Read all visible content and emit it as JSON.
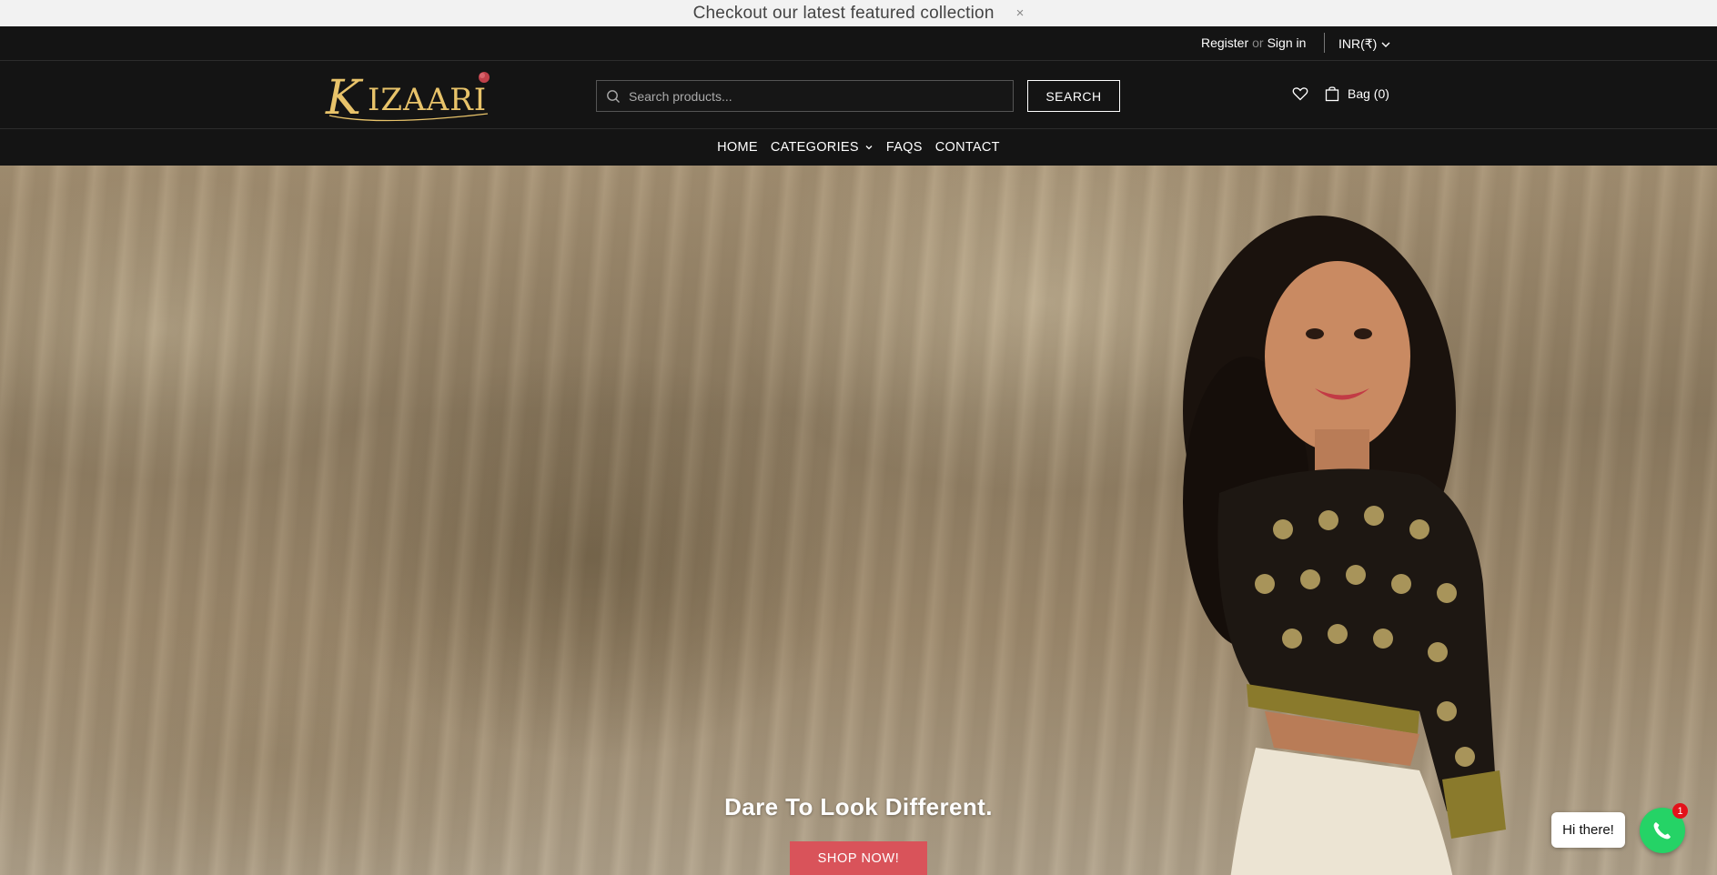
{
  "announcement": {
    "text": "Checkout our latest featured collection",
    "close": "×"
  },
  "topbar": {
    "register": "Register",
    "or": "or",
    "signin": "Sign in",
    "currency": "INR(₹)"
  },
  "header": {
    "logo_text": "KIZAARI",
    "search_placeholder": "Search products...",
    "search_button": "SEARCH",
    "wishlist_icon": "heart-icon",
    "bag_label": "Bag (0)"
  },
  "nav": {
    "items": [
      {
        "label": "HOME"
      },
      {
        "label": "CATEGORIES"
      },
      {
        "label": "FAQS"
      },
      {
        "label": "CONTACT"
      }
    ]
  },
  "hero": {
    "title": "Dare To Look Different.",
    "cta": "SHOP NOW!"
  },
  "chat": {
    "greeting": "Hi there!",
    "badge": "1"
  },
  "colors": {
    "accent": "#d9535a",
    "logo_gold": "#e8c36a",
    "whatsapp": "#25d366"
  }
}
